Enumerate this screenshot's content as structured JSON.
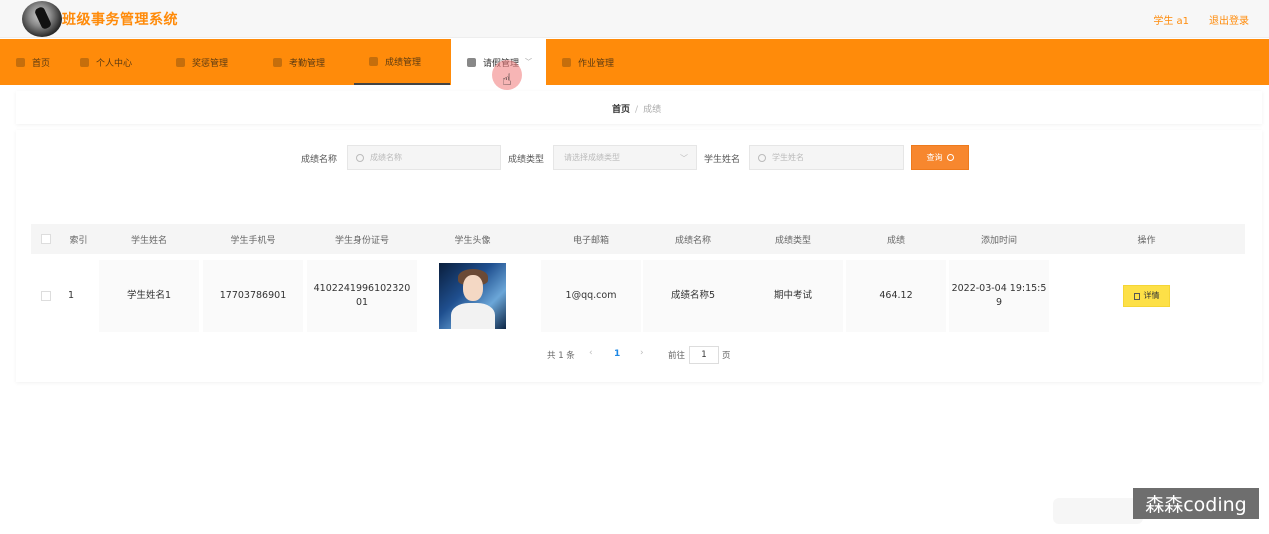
{
  "header": {
    "title": "班级事务管理系统",
    "user": "学生 a1",
    "logout": "退出登录"
  },
  "nav": {
    "items": [
      {
        "label": "首页",
        "icon": "home-icon"
      },
      {
        "label": "个人中心",
        "icon": "user-icon"
      },
      {
        "label": "奖惩管理",
        "icon": "award-icon"
      },
      {
        "label": "考勤管理",
        "icon": "calendar-icon"
      },
      {
        "label": "成绩管理",
        "icon": "grade-icon"
      },
      {
        "label": "请假管理",
        "icon": "leave-icon"
      },
      {
        "label": "作业管理",
        "icon": "homework-icon"
      }
    ],
    "active_index": 5,
    "underlined_index": 4
  },
  "breadcrumb": {
    "home": "首页",
    "separator": "/",
    "current": "成绩"
  },
  "filters": {
    "name_label": "成绩名称",
    "name_placeholder": "成绩名称",
    "type_label": "成绩类型",
    "type_placeholder": "请选择成绩类型",
    "student_label": "学生姓名",
    "student_placeholder": "学生姓名",
    "search_button": "查询"
  },
  "table": {
    "columns": [
      "索引",
      "学生姓名",
      "学生手机号",
      "学生身份证号",
      "学生头像",
      "电子邮箱",
      "成绩名称",
      "成绩类型",
      "成绩",
      "添加时间",
      "操作"
    ],
    "rows": [
      {
        "index": "1",
        "name": "学生姓名1",
        "phone": "17703786901",
        "id_card": "410224199610232001",
        "id_card_line1": "4102241996102320",
        "id_card_line2": "01",
        "email": "1@qq.com",
        "grade_name": "成绩名称5",
        "grade_type": "期中考试",
        "score": "464.12",
        "added_line1": "2022-03-04 19:15:5",
        "added_line2": "9",
        "action": "详情"
      }
    ]
  },
  "pagination": {
    "total": "共 1 条",
    "prev": "‹",
    "current_page": "1",
    "next": "›",
    "goto_label": "前往",
    "goto_value": "1",
    "page_suffix": "页"
  },
  "watermark": "森森coding",
  "colors": {
    "accent": "#ff8b0a",
    "search_button": "#f7872e",
    "detail_button": "#fde047",
    "page_active": "#1e88e5"
  }
}
